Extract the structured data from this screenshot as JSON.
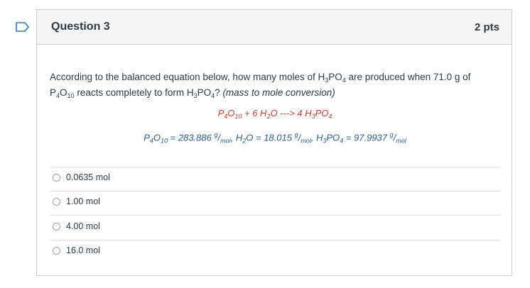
{
  "flag_icon": "bookmark-flag-icon",
  "question": {
    "title": "Question 3",
    "points": "2 pts",
    "text_1": "According to the balanced equation below, how many moles of H",
    "text_sub_3": "3",
    "text_2": "PO",
    "text_sub_4": "4",
    "text_3": " are produced when 71.0 g of",
    "text_line2_1": "P",
    "text_line2_sub4": "4",
    "text_line2_2": "O",
    "text_line2_sub10": "10",
    "text_line2_3": " reacts completely to form H",
    "text_line2_4": "PO",
    "text_line2_5": "? ",
    "note": "(mass to mole conversion)"
  },
  "equation": {
    "p": "P",
    "o": "O",
    "plus": " + 6 H",
    "h2o_tail": "O ---> 4 H",
    "h3po4_tail": "PO"
  },
  "molar_masses": {
    "p4o10_value": " = 283.886 ",
    "h2o_value": " = 18.015 ",
    "h3po4_value": " = 97.9937 ",
    "unit_g": "g",
    "unit_mol": "mol",
    "sep": ", "
  },
  "answers": [
    {
      "label": "0.0635 mol"
    },
    {
      "label": "1.00 mol"
    },
    {
      "label": "4.00 mol"
    },
    {
      "label": "16.0 mol"
    }
  ],
  "colors": {
    "equation": "#d53b2a",
    "molar": "#2b5c9c",
    "flag": "#2b7abc"
  }
}
